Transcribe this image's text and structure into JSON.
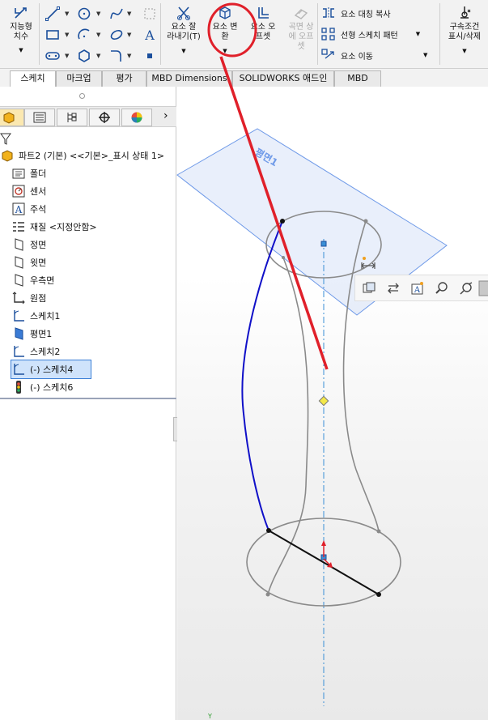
{
  "ribbon": {
    "smart_dimension_label": "지능형\n치수",
    "trim_label": "요소 잘\n라내기(T)",
    "convert_label": "요소 변\n환",
    "offset_label": "요소 오\n프셋",
    "offset_surface_label": "곡면 상\n에 오프\n셋",
    "mirror_label": "요소 대칭 복사",
    "linear_pattern_label": "선형 스케치 패턴",
    "move_label": "요소 이동",
    "relations_label": "구속조건\n표시/삭제"
  },
  "tabs": [
    "스케치",
    "마크업",
    "평가",
    "MBD Dimensions",
    "SOLIDWORKS 애드인",
    "MBD"
  ],
  "active_tab": "스케치",
  "tree": {
    "root": "파트2 (기본) <<기본>_표시 상태 1>",
    "items": [
      "폴더",
      "센서",
      "주석",
      "재질 <지정안함>",
      "정면",
      "윗면",
      "우측면",
      "원점",
      "스케치1",
      "평면1",
      "스케치2",
      "(-) 스케치4",
      "(-) 스케치6"
    ],
    "selected": "(-) 스케치4"
  },
  "viewport": {
    "plane_label": "평면1",
    "axis_label": "Y"
  },
  "colors": {
    "annotation_red": "#e0202a",
    "selected_sketch_blue": "#1010c8",
    "plane_blue": "#6f9ae8",
    "highlight_bg": "#cfe3fb"
  }
}
